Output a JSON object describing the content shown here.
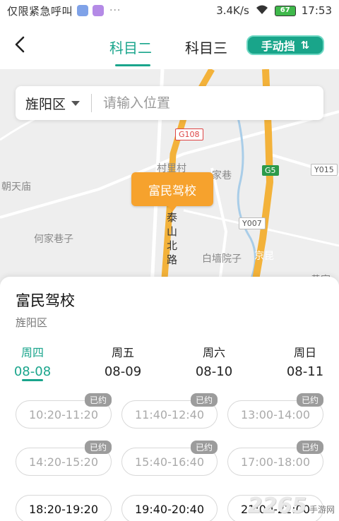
{
  "statusbar": {
    "carrier": "仅限紧急呼叫",
    "speed": "3.4K/s",
    "battery": "67",
    "time": "17:53"
  },
  "nav": {
    "tabs": [
      "科目二",
      "科目三"
    ],
    "active_tab": 0,
    "gear_button": "手动挡",
    "gear_symbol": "⇅"
  },
  "search": {
    "district": "旌阳区",
    "placeholder": "请输入位置"
  },
  "map": {
    "marker": "富民驾校",
    "labels": [
      "朝天庙",
      "村里村",
      "家巷",
      "何家巷子",
      "泰山北路",
      "白墙院子",
      "京昆",
      "黄家院"
    ],
    "badges": [
      "G108",
      "G5",
      "Y015",
      "Y007"
    ]
  },
  "school": {
    "name": "富民驾校",
    "district": "旌阳区"
  },
  "days": [
    {
      "weekday": "周四",
      "date": "08-08"
    },
    {
      "weekday": "周五",
      "date": "08-09"
    },
    {
      "weekday": "周六",
      "date": "08-10"
    },
    {
      "weekday": "周日",
      "date": "08-11"
    }
  ],
  "active_day": 0,
  "booked_label": "已约",
  "slots": [
    {
      "time": "10:20-11:20",
      "booked": true
    },
    {
      "time": "11:40-12:40",
      "booked": true
    },
    {
      "time": "13:00-14:00",
      "booked": true
    },
    {
      "time": "14:20-15:20",
      "booked": true
    },
    {
      "time": "15:40-16:40",
      "booked": true
    },
    {
      "time": "17:00-18:00",
      "booked": true
    },
    {
      "time": "18:20-19:20",
      "booked": false
    },
    {
      "time": "19:40-20:40",
      "booked": false
    },
    {
      "time": "21:00-22:00",
      "booked": false
    }
  ],
  "watermark": {
    "number": "2265",
    "text": "手游网"
  },
  "colors": {
    "accent": "#1aa58c",
    "marker": "#f6a22d",
    "booked_tag": "#9c9c9c"
  }
}
